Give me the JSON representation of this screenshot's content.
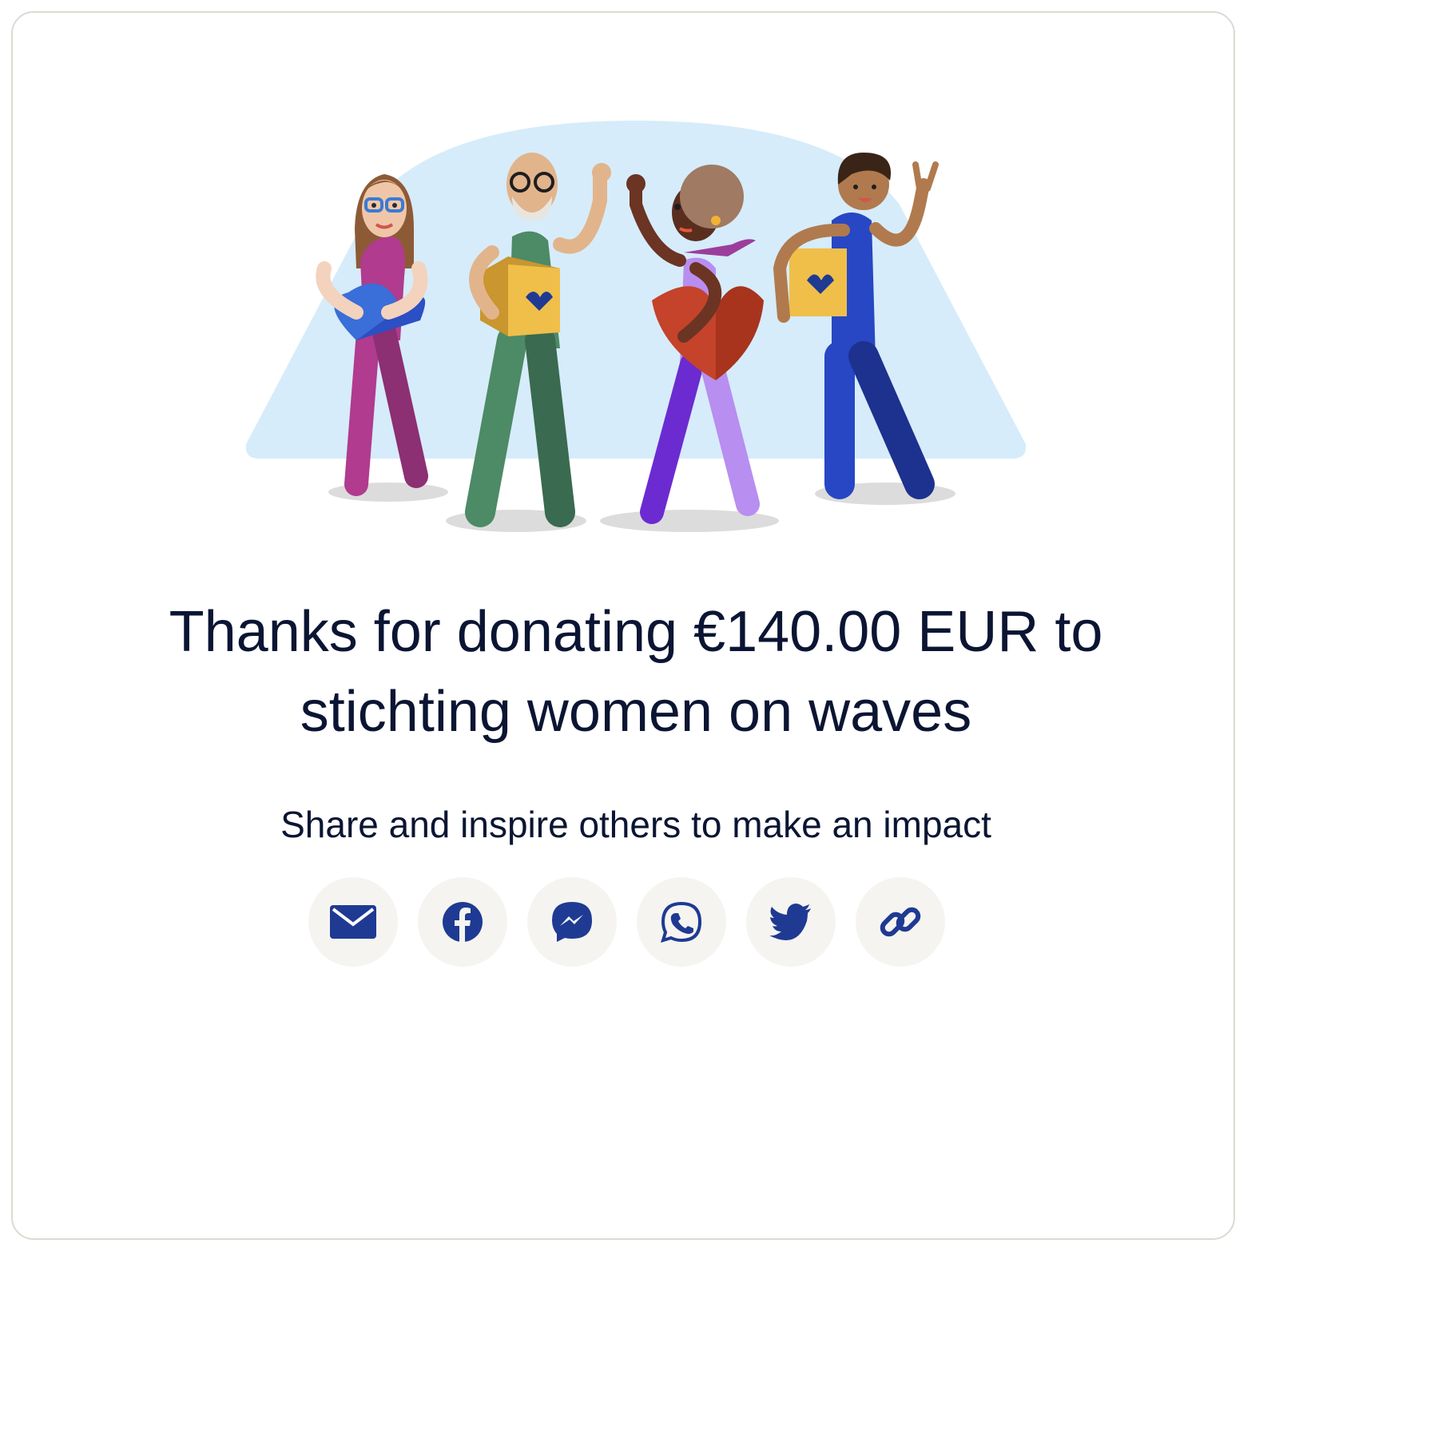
{
  "headline": {
    "line1": "Thanks for donating €140.00 EUR to",
    "line2": "stichting women on waves"
  },
  "subtitle": "Share and inspire others to make an impact",
  "share_buttons": [
    {
      "icon": "email-icon"
    },
    {
      "icon": "facebook-icon"
    },
    {
      "icon": "messenger-icon"
    },
    {
      "icon": "whatsapp-icon"
    },
    {
      "icon": "twitter-icon"
    },
    {
      "icon": "link-icon"
    }
  ],
  "colors": {
    "text": "#0b1533",
    "icon": "#1f3a93",
    "button_bg": "#f5f4f0",
    "arch": "#d6ecfa"
  }
}
